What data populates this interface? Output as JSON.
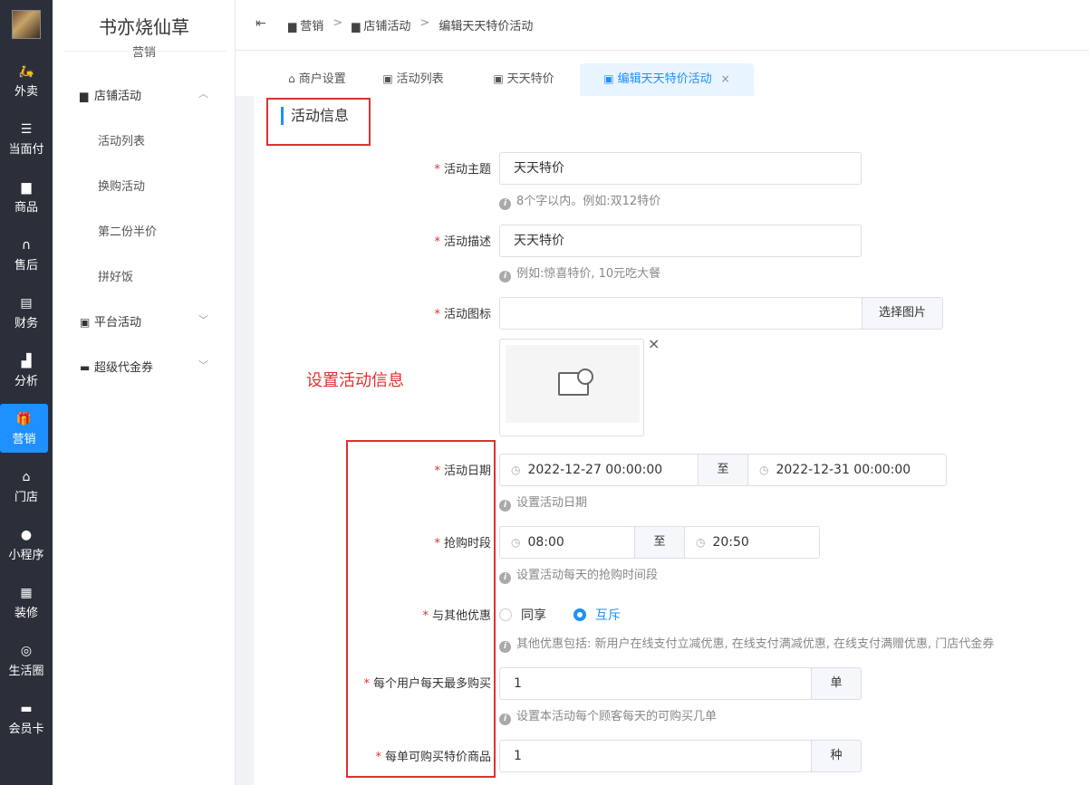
{
  "nav": {
    "items": [
      {
        "label": "外卖",
        "icon": "scooter-icon"
      },
      {
        "label": "当面付",
        "icon": "list-icon"
      },
      {
        "label": "商品",
        "icon": "bag-icon"
      },
      {
        "label": "售后",
        "icon": "headset-icon"
      },
      {
        "label": "财务",
        "icon": "finance-icon"
      },
      {
        "label": "分析",
        "icon": "bar-chart-icon"
      },
      {
        "label": "营销",
        "icon": "gift-icon"
      },
      {
        "label": "门店",
        "icon": "store-icon"
      },
      {
        "label": "小程序",
        "icon": "wechat-icon"
      },
      {
        "label": "装修",
        "icon": "decorate-icon"
      },
      {
        "label": "生活圈",
        "icon": "circle-icon"
      },
      {
        "label": "会员卡",
        "icon": "card-icon"
      }
    ]
  },
  "sidebar": {
    "brand": "书亦烧仙草",
    "section": "营销",
    "groups": [
      {
        "label": "店铺活动",
        "icon": "shop-icon"
      },
      {
        "label": "平台活动",
        "icon": "gift-icon"
      },
      {
        "label": "超级代金券",
        "icon": "ticket-icon"
      }
    ],
    "items": [
      "活动列表",
      "换购活动",
      "第二份半价",
      "拼好饭"
    ]
  },
  "breadcrumb": [
    "营销",
    "店铺活动",
    "编辑天天特价活动"
  ],
  "tabs": [
    "商户设置",
    "活动列表",
    "天天特价",
    "编辑天天特价活动"
  ],
  "section_title": "活动信息",
  "annotation": "设置活动信息",
  "form": {
    "theme_label": "活动主题",
    "theme_value": "天天特价",
    "theme_hint": "8个字以内。例如:双12特价",
    "desc_label": "活动描述",
    "desc_value": "天天特价",
    "desc_hint": "例如:惊喜特价, 10元吃大餐",
    "icon_label": "活动图标",
    "icon_button": "选择图片",
    "date_label": "活动日期",
    "date_start": "2022-12-27 00:00:00",
    "date_to": "至",
    "date_end": "2022-12-31 00:00:00",
    "date_hint": "设置活动日期",
    "time_label": "抢购时段",
    "time_start": "08:00",
    "time_to": "至",
    "time_end": "20:50",
    "time_hint": "设置活动每天的抢购时间段",
    "other_label": "与其他优惠",
    "other_opt1": "同享",
    "other_opt2": "互斥",
    "other_hint": "其他优惠包括: 新用户在线支付立减优惠, 在线支付满减优惠, 在线支付满赠优惠, 门店代金券",
    "limit_label": "每个用户每天最多购买",
    "limit_value": "1",
    "limit_unit": "单",
    "limit_hint": "设置本活动每个顾客每天的可购买几单",
    "count_label": "每单可购买特价商品",
    "count_value": "1",
    "count_unit": "种"
  }
}
